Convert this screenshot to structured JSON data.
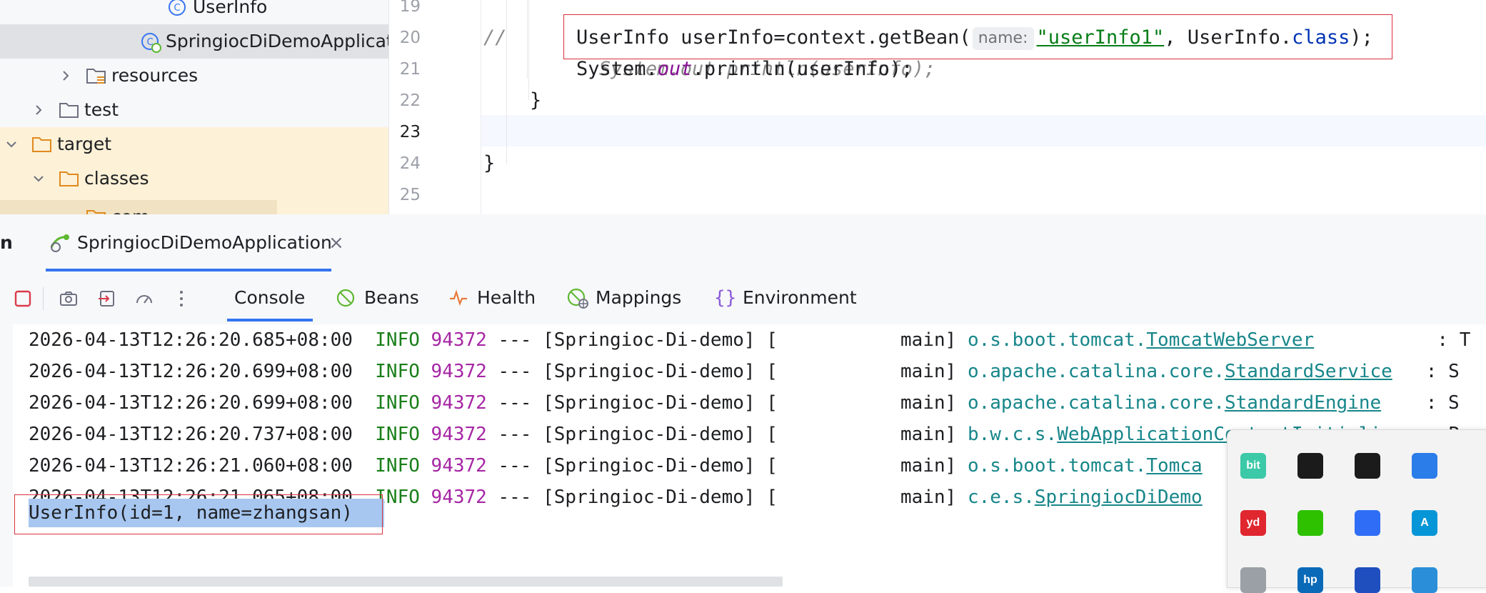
{
  "project_tree": {
    "items": [
      {
        "label": "UserInfo",
        "icon": "class-icon"
      },
      {
        "label": "SpringiocDiDemoApplicatic",
        "icon": "spring-boot-class-icon"
      },
      {
        "label": "resources",
        "icon": "resources-folder-icon"
      },
      {
        "label": "test",
        "icon": "folder-icon"
      },
      {
        "label": "target",
        "icon": "excluded-folder-icon"
      },
      {
        "label": "classes",
        "icon": "excluded-folder-icon"
      },
      {
        "label": "com",
        "icon": "excluded-folder-icon"
      }
    ]
  },
  "editor": {
    "line_numbers": [
      "19",
      "20",
      "21",
      "22",
      "23",
      "24",
      "25"
    ],
    "lines": {
      "l19_comment_mark": "//",
      "l19_comment_code": "System.out.println(userInfo);",
      "l20_code_a": "UserInfo userInfo=context.getBean(",
      "l20_hint": "name:",
      "l20_string": "\"userInfo1\"",
      "l20_code_b": ", UserInfo.",
      "l20_keyword": "class",
      "l20_code_c": ");",
      "l21_code_a": "System.",
      "l21_field": "out",
      "l21_code_b": ".println(userInfo);",
      "l22_code": "}",
      "l24_code": "}"
    }
  },
  "run_window": {
    "tab_prefix": "n",
    "tab_label": "SpringiocDiDemoApplication",
    "tab_close": "×",
    "toolbar_tabs": [
      {
        "label": "Console",
        "icon": "console-icon"
      },
      {
        "label": "Beans",
        "icon": "beans-icon"
      },
      {
        "label": "Health",
        "icon": "health-icon"
      },
      {
        "label": "Mappings",
        "icon": "mappings-icon"
      },
      {
        "label": "Environment",
        "icon": "environment-icon"
      }
    ]
  },
  "console": {
    "log_lines": [
      {
        "ts": "2026-04-13T12:26:20.685+08:00",
        "level": "INFO",
        "pid": "94372",
        "sep": "---",
        "app": "[Springioc-Di-demo]",
        "thread": "[           main]",
        "logger_prefix": "o.s.boot.tomcat.",
        "logger_class": "TomcatWebServer",
        "tail": "           : T"
      },
      {
        "ts": "2026-04-13T12:26:20.699+08:00",
        "level": "INFO",
        "pid": "94372",
        "sep": "---",
        "app": "[Springioc-Di-demo]",
        "thread": "[           main]",
        "logger_prefix": "o.apache.catalina.core.",
        "logger_class": "StandardService",
        "tail": "   : S"
      },
      {
        "ts": "2026-04-13T12:26:20.699+08:00",
        "level": "INFO",
        "pid": "94372",
        "sep": "---",
        "app": "[Springioc-Di-demo]",
        "thread": "[           main]",
        "logger_prefix": "o.apache.catalina.core.",
        "logger_class": "StandardEngine",
        "tail": "    : S"
      },
      {
        "ts": "2026-04-13T12:26:20.737+08:00",
        "level": "INFO",
        "pid": "94372",
        "sep": "---",
        "app": "[Springioc-Di-demo]",
        "thread": "[           main]",
        "logger_prefix": "b.w.c.s.",
        "logger_class": "WebApplicationContextInitializer",
        "tail": " : P"
      },
      {
        "ts": "2026-04-13T12:26:21.060+08:00",
        "level": "INFO",
        "pid": "94372",
        "sep": "---",
        "app": "[Springioc-Di-demo]",
        "thread": "[           main]",
        "logger_prefix": "o.s.boot.tomcat.",
        "logger_class": "Tomca",
        "tail": ""
      },
      {
        "ts": "2026-04-13T12:26:21.065+08:00",
        "level": "INFO",
        "pid": "94372",
        "sep": "---",
        "app": "[Springioc-Di-demo]",
        "thread": "[           main]",
        "logger_prefix": "c.e.s.",
        "logger_class": "SpringiocDiDemo",
        "tail": ""
      }
    ],
    "output_line": "UserInfo(id=1, name=zhangsan)"
  },
  "tray": {
    "icons": [
      {
        "name": "bit-icon",
        "text": "bit",
        "color": "#3cc9a8"
      },
      {
        "name": "game-controller-icon",
        "text": "",
        "color": "#1b1b1b"
      },
      {
        "name": "notes-app-icon",
        "text": "",
        "color": "#1b1b1b"
      },
      {
        "name": "screen-app-icon",
        "text": "",
        "color": "#2b7de9"
      },
      {
        "name": "youdao-icon",
        "text": "yd",
        "color": "#e0262f"
      },
      {
        "name": "wechat-icon",
        "text": "",
        "color": "#2dc100"
      },
      {
        "name": "feishu-icon",
        "text": "",
        "color": "#2f6df6"
      },
      {
        "name": "autodesk-icon",
        "text": "A",
        "color": "#0696d7"
      },
      {
        "name": "disabled-app-icon",
        "text": "",
        "color": "#9aa0a6"
      },
      {
        "name": "hp-icon",
        "text": "hp",
        "color": "#0a6ab8"
      },
      {
        "name": "link-app-icon",
        "text": "",
        "color": "#1f4fbf"
      },
      {
        "name": "security-icon",
        "text": "",
        "color": "#2a8fd8"
      }
    ]
  },
  "colors": {
    "highlight_box": "#d8303b",
    "selection": "#a7c7f0",
    "info_level": "#1a7f1a",
    "pid": "#a626a4",
    "logger": "#17868a"
  }
}
